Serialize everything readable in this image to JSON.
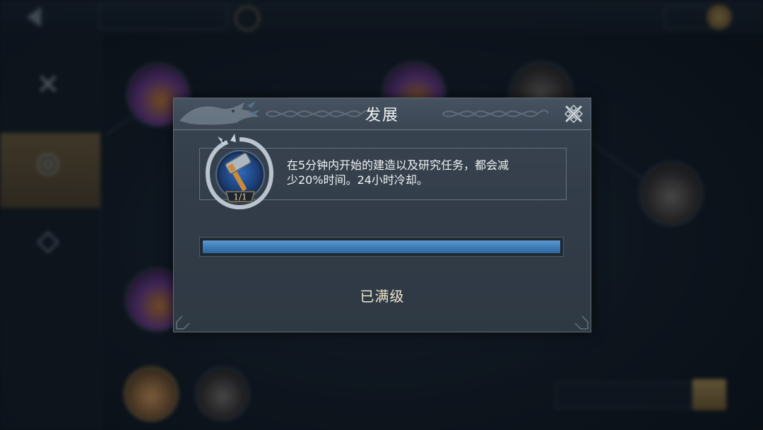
{
  "dialog": {
    "title": "发展",
    "skill": {
      "level_text": "1/1",
      "icon": "hammer-icon",
      "description_line1": "在5分钟内开始的建造以及研究任务，都会减",
      "description_line2": "少20%时间。24小时冷却。"
    },
    "progress_fraction": 1.0,
    "status": "已满级",
    "close_icon": "close-icon"
  },
  "colors": {
    "panel_bg": "#323d49",
    "header_bg": "#46525f",
    "progress_fill": "#3f7cb8",
    "status_text": "#f0e6cc",
    "accent_gold": "#a58a4e"
  }
}
